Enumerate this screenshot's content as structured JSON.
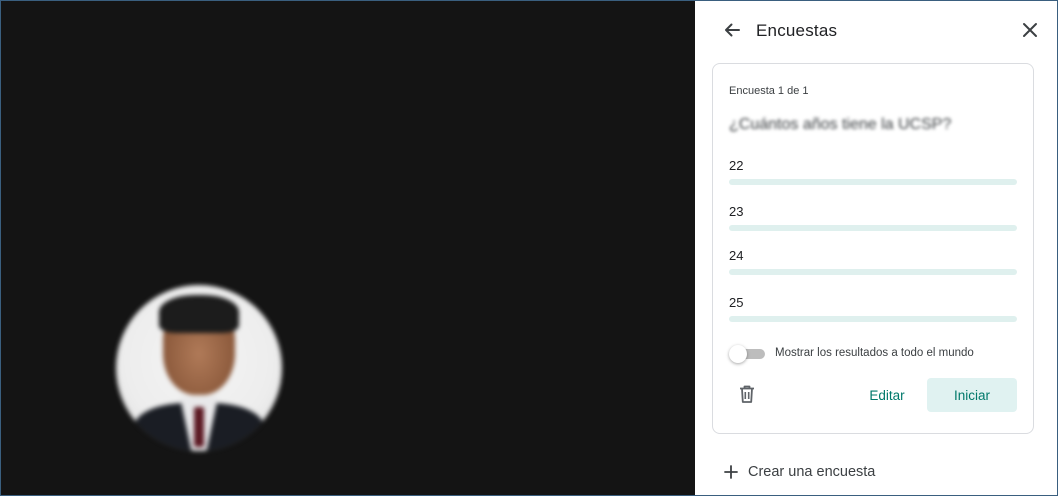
{
  "panel": {
    "title": "Encuestas",
    "back_icon": "arrow-back-icon",
    "close_icon": "close-icon"
  },
  "poll": {
    "counter": "Encuesta 1 de 1",
    "question": "¿Cuántos años tiene la UCSP?",
    "options": [
      {
        "label": "22"
      },
      {
        "label": "23"
      },
      {
        "label": "24"
      },
      {
        "label": "25"
      }
    ],
    "show_results_label": "Mostrar los resultados a todo el mundo",
    "show_results_enabled": false,
    "edit_label": "Editar",
    "start_label": "Iniciar",
    "delete_icon": "trash-icon"
  },
  "create_poll_label": "Crear una encuesta",
  "colors": {
    "accent": "#00796b",
    "accent_bg": "#e0f2f1",
    "bar": "#dff0ee",
    "video_bg": "#141414"
  }
}
